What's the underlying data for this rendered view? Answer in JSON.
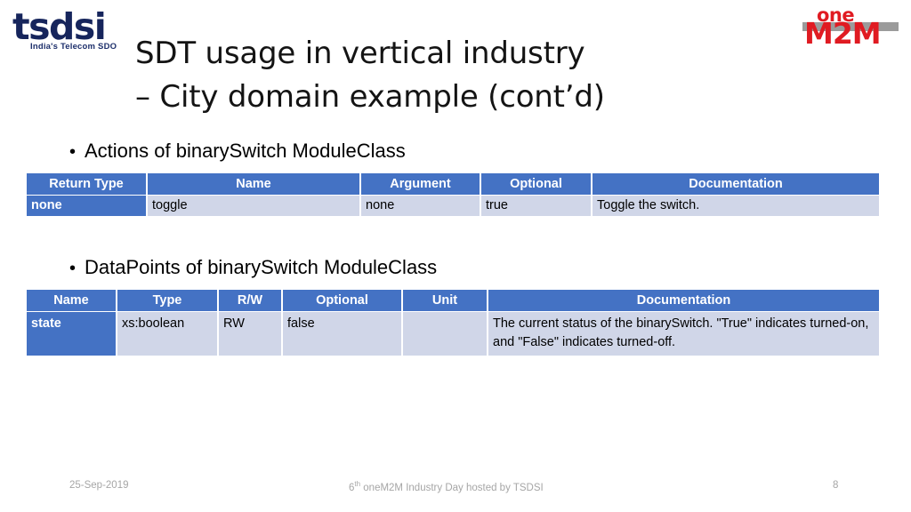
{
  "logos": {
    "tsdsi": {
      "word": "tsdsi",
      "tagline": "India's Telecom SDO"
    },
    "onem2m": {
      "one": "one",
      "m2m": "M2M"
    }
  },
  "title": {
    "line1": "SDT usage in vertical industry",
    "line2": "– City domain example (cont’d)"
  },
  "bullets": {
    "actions": "Actions of binarySwitch ModuleClass",
    "datapoints": "DataPoints of binarySwitch ModuleClass",
    "marker": "•"
  },
  "tables": {
    "actions": {
      "headers": [
        "Return Type",
        "Name",
        "Argument",
        "Optional",
        "Documentation"
      ],
      "rows": [
        [
          "none",
          "toggle",
          "none",
          "true",
          "Toggle the switch."
        ]
      ]
    },
    "datapoints": {
      "headers": [
        "Name",
        "Type",
        "R/W",
        "Optional",
        "Unit",
        "Documentation"
      ],
      "rows": [
        [
          "state",
          "xs:boolean",
          "RW",
          "false",
          "",
          "The current status of the binarySwitch. \"True\" indicates turned-on, and \"False\" indicates turned-off."
        ]
      ]
    }
  },
  "footer": {
    "date": "25-Sep-2019",
    "event_prefix": "6",
    "event_sup": "th",
    "event_rest": " oneM2M Industry Day hosted by TSDSI",
    "page_number": "8"
  },
  "colors": {
    "header_blue": "#4472c4",
    "cell_lavender": "#d0d6e8",
    "brand_red": "#e01b22",
    "brand_navy": "#16255c",
    "footer_grey": "#a6a6a6"
  }
}
